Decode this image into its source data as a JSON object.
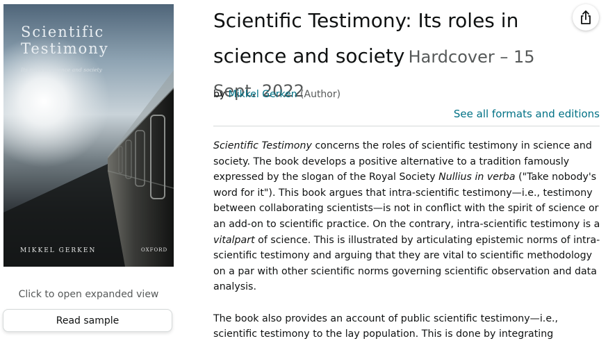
{
  "cover": {
    "title": "Scientific\nTestimony",
    "subtitle": "Its roles in science and society",
    "author": "MIKKEL GERKEN",
    "publisher": "OXFORD"
  },
  "gallery": {
    "expand_caption": "Click to open expanded view",
    "read_sample_label": "Read sample"
  },
  "product": {
    "title": "Scientific Testimony: Its roles in science and society",
    "subtitle": "Hardcover – 15 Sept. 2022",
    "by_prefix": "by",
    "author_name": "Mikkel Gerken",
    "author_role": "(Author)",
    "formats_link": "See all formats and editions"
  },
  "description": {
    "p1_title": "Scientific Testimony",
    "p1_a": " concerns the roles of scientific testimony in science and society. The book develops a positive alternative to a tradition famously expressed by the slogan of the Royal Society ",
    "p1_motto": "Nullius in verba",
    "p1_b": " (\"Take nobody's word for it\"). This book argues that intra-scientific testimony—i.e., testimony between collaborating scientists—is not in conflict with the spirit of science or an add-on to scientific practice. On the contrary, intra-scientific testimony is a ",
    "p1_vital": "vitalpart",
    "p1_c": " of science. This is illustrated by articulating epistemic norms of intra-scientific testimony and arguing that they are vital to scientific methodology on a par with other scientific norms governing scientific observation and data analysis.",
    "p2": "The book also provides an account of public scientific testimony—i.e., scientific testimony to the lay population. This is done by integrating"
  },
  "icons": {
    "share": "share-icon"
  }
}
